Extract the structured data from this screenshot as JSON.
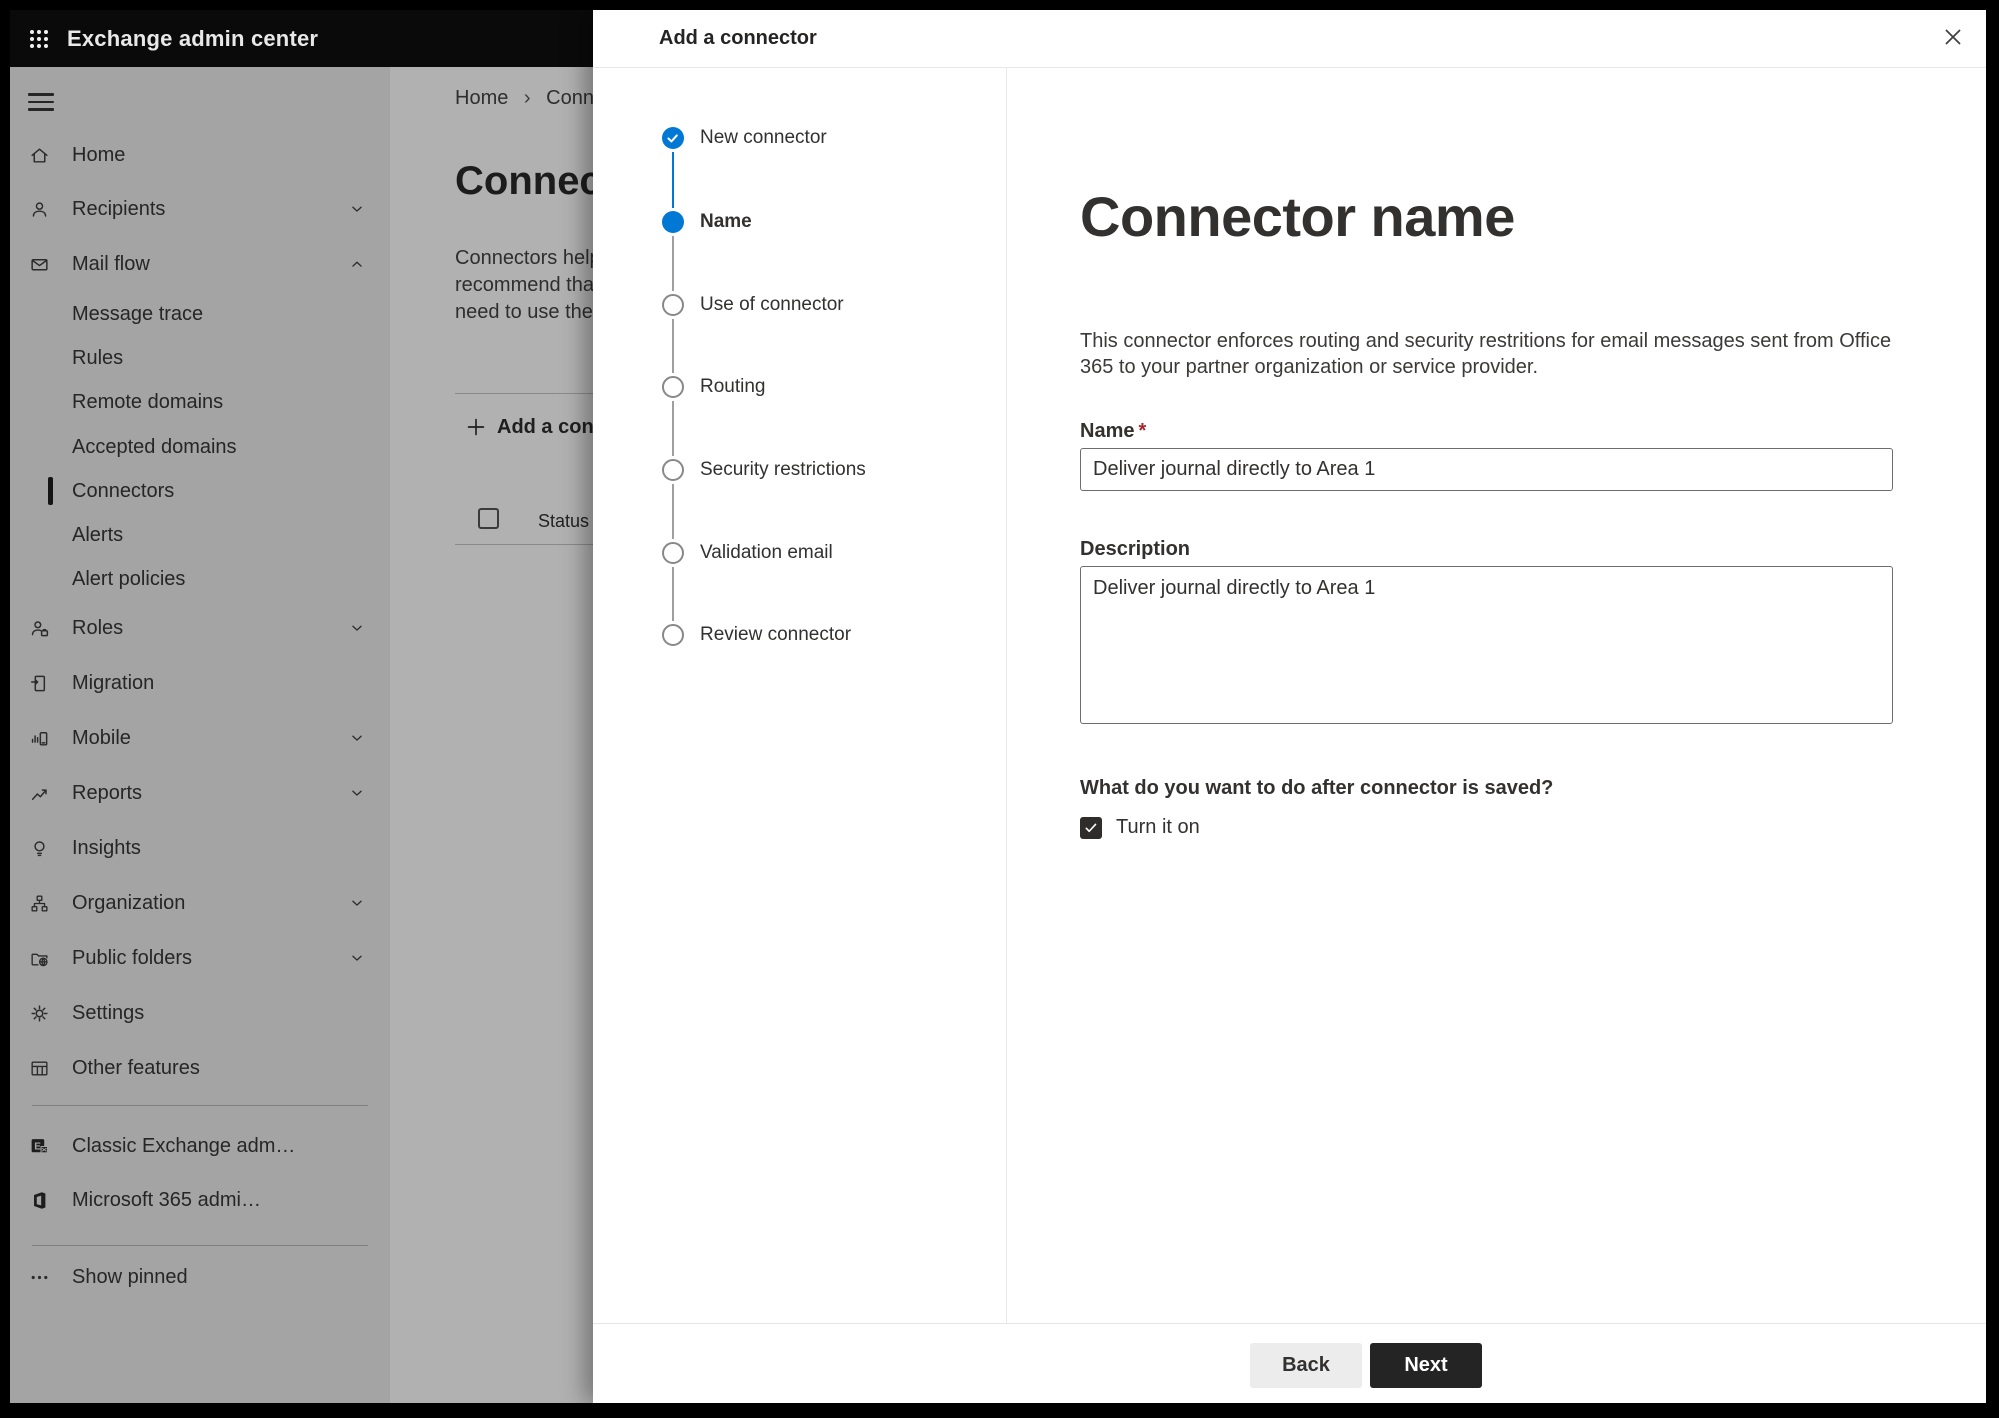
{
  "chrome": {
    "app_title": "Exchange admin center"
  },
  "sidebar": {
    "items": [
      {
        "label": "Home"
      },
      {
        "label": "Recipients"
      },
      {
        "label": "Mail flow"
      },
      {
        "label": "Message trace"
      },
      {
        "label": "Rules"
      },
      {
        "label": "Remote domains"
      },
      {
        "label": "Accepted domains"
      },
      {
        "label": "Connectors"
      },
      {
        "label": "Alerts"
      },
      {
        "label": "Alert policies"
      },
      {
        "label": "Roles"
      },
      {
        "label": "Migration"
      },
      {
        "label": "Mobile"
      },
      {
        "label": "Reports"
      },
      {
        "label": "Insights"
      },
      {
        "label": "Organization"
      },
      {
        "label": "Public folders"
      },
      {
        "label": "Settings"
      },
      {
        "label": "Other features"
      },
      {
        "label": "Classic Exchange adm…"
      },
      {
        "label": "Microsoft 365 admi…"
      },
      {
        "label": "Show pinned"
      }
    ],
    "selected": "Connectors"
  },
  "page": {
    "breadcrumb_home": "Home",
    "breadcrumb_current": "Conne",
    "title_fragment": "Connec",
    "paragraph_line1": "Connectors help",
    "paragraph_line2": "recommend tha",
    "paragraph_line3": "need to use ther",
    "add_button_fragment": "Add a conn",
    "status_header": "Status"
  },
  "dialog": {
    "title": "Add a connector",
    "steps": [
      {
        "label": "New connector",
        "state": "completed"
      },
      {
        "label": "Name",
        "state": "current"
      },
      {
        "label": "Use of connector",
        "state": "upcoming"
      },
      {
        "label": "Routing",
        "state": "upcoming"
      },
      {
        "label": "Security restrictions",
        "state": "upcoming"
      },
      {
        "label": "Validation email",
        "state": "upcoming"
      },
      {
        "label": "Review connector",
        "state": "upcoming"
      }
    ],
    "content": {
      "heading": "Connector name",
      "description": "This connector enforces routing and security restritions for email messages sent from Office 365 to your partner organization or service provider.",
      "name_label": "Name",
      "required_marker": "*",
      "name_value": "Deliver journal directly to Area 1",
      "description_label": "Description",
      "description_value": "Deliver journal directly to Area 1",
      "after_save_question": "What do you want to do after connector is saved?",
      "turn_on_label": "Turn it on",
      "turn_on_checked": true
    },
    "footer": {
      "back_label": "Back",
      "next_label": "Next"
    }
  },
  "colors": {
    "accent_blue": "#0078d4",
    "required_red": "#a4262c",
    "next_button_bg": "#242424",
    "back_button_bg": "#ececec",
    "topbar_bg": "#0a0a0a"
  }
}
